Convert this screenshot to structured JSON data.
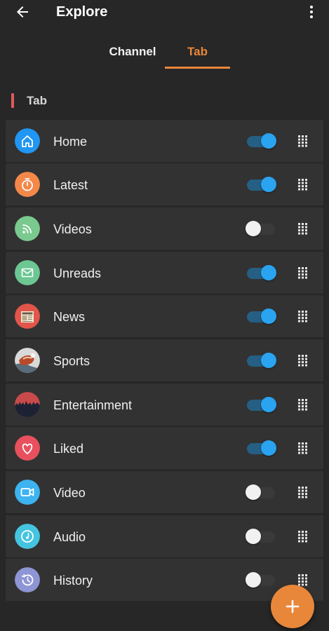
{
  "app_bar": {
    "title": "Explore",
    "back_icon": "arrow-back-icon",
    "menu_icon": "more-vert-icon"
  },
  "tabs": [
    {
      "label": "Channel",
      "active": false
    },
    {
      "label": "Tab",
      "active": true
    }
  ],
  "section": {
    "label": "Tab"
  },
  "colors": {
    "accent": "#e8873a",
    "toggle_on": "#2aa3f0",
    "background": "#272727",
    "row": "#323232"
  },
  "items": [
    {
      "label": "Home",
      "icon": "home-icon",
      "color": "#2196f3",
      "enabled": true
    },
    {
      "label": "Latest",
      "icon": "stopwatch-icon",
      "color": "#f4874a",
      "enabled": true
    },
    {
      "label": "Videos",
      "icon": "rss-icon",
      "color": "#7ac98f",
      "enabled": false
    },
    {
      "label": "Unreads",
      "icon": "mail-icon",
      "color": "#6cc792",
      "enabled": true
    },
    {
      "label": "News",
      "icon": "newspaper-icon",
      "color": "#e2554a",
      "enabled": true
    },
    {
      "label": "Sports",
      "icon": "sports-photo-icon",
      "color": "#c9c9c9",
      "enabled": true
    },
    {
      "label": "Entertainment",
      "icon": "concert-crowd-icon",
      "color": "#c94a4a",
      "enabled": true
    },
    {
      "label": "Liked",
      "icon": "heart-icon",
      "color": "#e8505e",
      "enabled": true
    },
    {
      "label": "Video",
      "icon": "videocam-icon",
      "color": "#3db3f0",
      "enabled": false
    },
    {
      "label": "Audio",
      "icon": "music-disc-icon",
      "color": "#45c4e0",
      "enabled": false
    },
    {
      "label": "History",
      "icon": "history-icon",
      "color": "#8e95d4",
      "enabled": false
    }
  ],
  "fab": {
    "icon": "plus-icon"
  }
}
